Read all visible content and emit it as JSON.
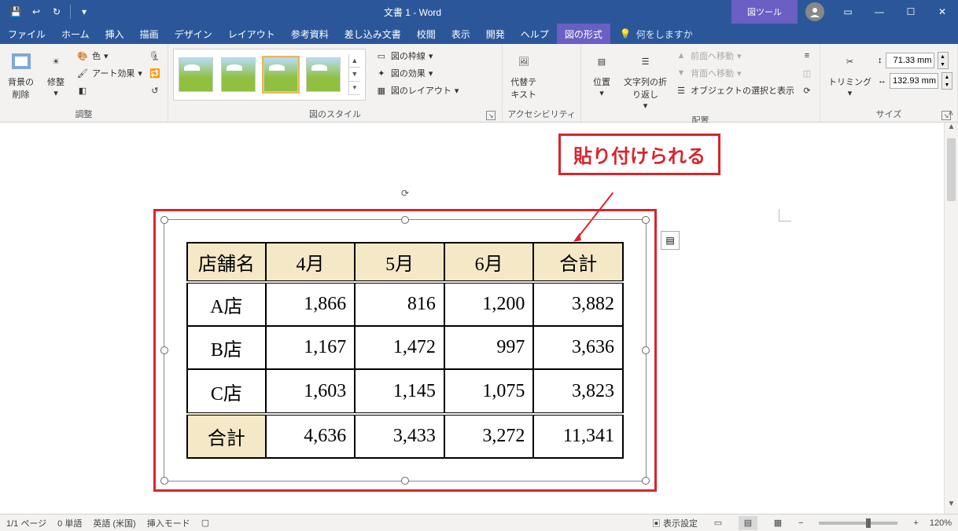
{
  "title": "文書 1 - Word",
  "contextual_tab_group": "図ツール",
  "qat": {
    "save": "保存",
    "undo": "元に戻す",
    "redo": "やり直し"
  },
  "window": {
    "ribbon_opts": "⧉",
    "min": "—",
    "max": "☐",
    "close": "✕"
  },
  "tabs": [
    "ファイル",
    "ホーム",
    "挿入",
    "描画",
    "デザイン",
    "レイアウト",
    "参考資料",
    "差し込み文書",
    "校閲",
    "表示",
    "開発",
    "ヘルプ"
  ],
  "active_tab": "図の形式",
  "tell_me_placeholder": "何をしますか",
  "ribbon": {
    "adjust": {
      "label": "調整",
      "remove_bg": "背景の\n削除",
      "corrections": "修整",
      "color": "色",
      "artistic": "アート効果",
      "transparency": "透明度▾"
    },
    "styles": {
      "label": "図のスタイル",
      "border": "図の枠線",
      "effects": "図の効果",
      "layout": "図のレイアウト"
    },
    "accessibility": {
      "label": "アクセシビリティ",
      "alt_text": "代替テ\nキスト"
    },
    "arrange": {
      "label": "配置",
      "position": "位置",
      "wrap": "文字列の折\nり返し",
      "bring_forward": "前面へ移動",
      "send_backward": "背面へ移動",
      "selection_pane": "オブジェクトの選択と表示",
      "align": "配置▾",
      "group": "グループ▾",
      "rotate": "回転▾"
    },
    "size": {
      "label": "サイズ",
      "crop": "トリミング",
      "height": "71.33 mm",
      "width": "132.93 mm"
    }
  },
  "callout_text": "貼り付けられる",
  "table": {
    "headers": [
      "店舗名",
      "4月",
      "5月",
      "6月",
      "合計"
    ],
    "rows": [
      {
        "name": "A店",
        "vals": [
          "1,866",
          "816",
          "1,200",
          "3,882"
        ]
      },
      {
        "name": "B店",
        "vals": [
          "1,167",
          "1,472",
          "997",
          "3,636"
        ]
      },
      {
        "name": "C店",
        "vals": [
          "1,603",
          "1,145",
          "1,075",
          "3,823"
        ]
      }
    ],
    "sum": {
      "name": "合計",
      "vals": [
        "4,636",
        "3,433",
        "3,272",
        "11,341"
      ]
    }
  },
  "statusbar": {
    "page": "1/1 ページ",
    "words": "0 単語",
    "lang": "英語 (米国)",
    "insert": "挿入モード",
    "display_settings": "表示設定",
    "zoom_pct": "120%"
  },
  "icons": {
    "lightbulb": "💡",
    "save": "💾",
    "dropdown": "▾",
    "launcher": "↘"
  }
}
